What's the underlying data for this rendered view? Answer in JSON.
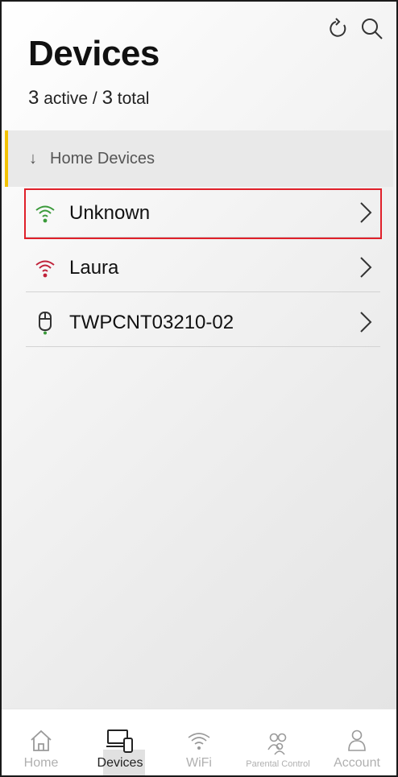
{
  "header": {
    "title": "Devices",
    "active_count": "3",
    "active_label": "active /",
    "total_count": "3",
    "total_label": "total"
  },
  "section": {
    "arrow": "↓",
    "label": "Home Devices"
  },
  "devices": [
    {
      "name": "Unknown",
      "icon": "wifi-icon",
      "status_color": "#3a9a3a",
      "selected": true
    },
    {
      "name": "Laura",
      "icon": "wifi-icon",
      "status_color": "#c0223a",
      "selected": false
    },
    {
      "name": "TWPCNT03210-02",
      "icon": "mouse-icon",
      "status_color": "#3a9a3a",
      "selected": false
    }
  ],
  "tabs": [
    {
      "label": "Home",
      "icon": "home-icon",
      "active": false
    },
    {
      "label": "Devices",
      "icon": "devices-icon",
      "active": true
    },
    {
      "label": "WiFi",
      "icon": "wifi-icon",
      "active": false
    },
    {
      "label": "Parental Control",
      "icon": "parental-control-icon",
      "active": false
    },
    {
      "label": "Account",
      "icon": "account-icon",
      "active": false
    }
  ],
  "colors": {
    "accent_bar": "#f2c200",
    "selection_outline": "#e0202a",
    "online_green": "#3a9a3a",
    "offline_red": "#c0223a"
  }
}
